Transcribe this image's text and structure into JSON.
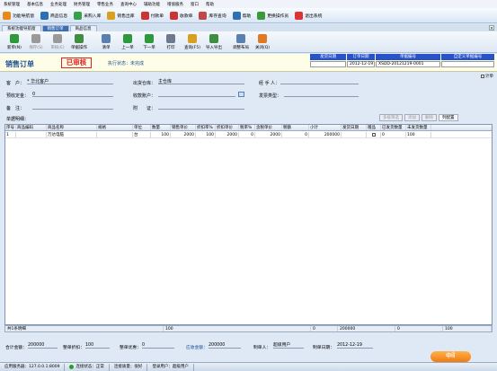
{
  "menu": [
    "系统管理",
    "基本信息",
    "业务处理",
    "财务管理",
    "零售业务",
    "查询中心",
    "辅助功能",
    "增值服务",
    "窗口",
    "帮助"
  ],
  "toolbar": [
    {
      "label": "功能导航窗",
      "icon": "navigation-icon",
      "color": "#e88a1a"
    },
    {
      "label": "商品信息",
      "icon": "product-info-icon",
      "color": "#2f6fb4"
    },
    {
      "label": "采购入库",
      "icon": "purchase-icon",
      "color": "#39a04a"
    },
    {
      "label": "销售出库",
      "icon": "sales-out-icon",
      "color": "#d9a020"
    },
    {
      "label": "付款单",
      "icon": "payment-icon",
      "color": "#c33"
    },
    {
      "label": "收款单",
      "icon": "receipt-icon",
      "color": "#c33"
    },
    {
      "label": "库存查询",
      "icon": "stock-query-icon",
      "color": "#c04848"
    },
    {
      "label": "帮助",
      "icon": "help-icon",
      "color": "#2f6fb4"
    },
    {
      "label": "更换操作员",
      "icon": "switch-user-icon",
      "color": "#3a9a3a"
    },
    {
      "label": "退出系统",
      "icon": "exit-icon",
      "color": "#d33"
    }
  ],
  "tabs": [
    "系统功能导航窗",
    "销售订单",
    "商品信息"
  ],
  "doc_toolbar": [
    {
      "label": "新单(N)",
      "icon": "new-doc-icon",
      "color": "#2c9a3a",
      "disabled": false
    },
    {
      "label": "保存(S)",
      "icon": "save-icon",
      "color": "#9a9a9a",
      "disabled": true
    },
    {
      "label": "审核(E)",
      "icon": "audit-icon",
      "color": "#9a9a9a",
      "disabled": true
    },
    {
      "label": "单据操作",
      "icon": "doc-ops-icon",
      "color": "#3f8d3f",
      "disabled": false
    },
    {
      "label": "清单",
      "icon": "list-icon",
      "color": "#5a7fb0",
      "disabled": false
    },
    {
      "label": "上一单",
      "icon": "prev-doc-icon",
      "color": "#2c9a3a",
      "disabled": false
    },
    {
      "label": "下一单",
      "icon": "next-doc-icon",
      "color": "#2c9a3a",
      "disabled": false
    },
    {
      "label": "打印",
      "icon": "print-icon",
      "color": "#6b7a8f",
      "disabled": false
    },
    {
      "label": "查询(F5)",
      "icon": "query-icon",
      "color": "#d9a020",
      "disabled": false
    },
    {
      "label": "导入导出",
      "icon": "import-export-icon",
      "color": "#3f8d3f",
      "disabled": false
    },
    {
      "label": "调整布局",
      "icon": "layout-icon",
      "color": "#5a7fb0",
      "disabled": false
    },
    {
      "label": "关闭(Q)",
      "icon": "close-doc-icon",
      "color": "#e07a20",
      "disabled": false
    }
  ],
  "header": {
    "title": "销售订单",
    "audit_stamp": "已审核",
    "exec_state": "执行状态：未完成",
    "grid_headers": [
      "发货日期",
      "订单日期",
      "单据编号",
      "自定义单据编号"
    ],
    "ship_date": "",
    "order_date": "2012-12-19",
    "doc_no": "XSDD-20121219-0001",
    "custom_no": ""
  },
  "option_checkbox": "计单",
  "form": {
    "customer_label": "客　户：",
    "customer_value": "* 华北客户",
    "warehouse_label": "出货仓库：",
    "warehouse_value": "主仓库",
    "handler_label": "经 手 人：",
    "handler_value": "",
    "deposit_label": "预收定金：",
    "deposit_value": "0",
    "account_label": "收款账户：",
    "account_value": "",
    "invoice_label": "发票类型：",
    "invoice_value": "",
    "remark_label": "备　注：",
    "remark_value": "",
    "attach_label": "附　　证：",
    "attach_value": "",
    "doc_detail_label": "单据明细："
  },
  "grid_buttons": [
    "多级筛选",
    "添加",
    "删除",
    "列配置"
  ],
  "grid": {
    "columns": [
      "序号",
      "商品编码",
      "商品名称",
      "规格",
      "单位",
      "数量",
      "销售单价",
      "折扣率%",
      "折扣单价",
      "税率%",
      "含税单价",
      "税额",
      "小计",
      "发货日期",
      "赠品",
      "已发货数量",
      "未发货数量"
    ],
    "rows": [
      [
        "1",
        "",
        "万达电脑",
        "",
        "台",
        "100",
        "2000",
        "100",
        "2000",
        "0",
        "2000",
        "0",
        "200000",
        "",
        "",
        "0",
        "100"
      ]
    ],
    "summary": {
      "row_count": "共1条明细",
      "qty": "100",
      "tax": "0",
      "subtotal": "200000",
      "shipped": "0",
      "unshipped": "100"
    }
  },
  "footer": {
    "total_amount_label": "合计金额：",
    "total_amount": "200000",
    "whole_discount_label": "整单折扣：",
    "whole_discount": "100",
    "whole_reduction_label": "整单优惠：",
    "whole_reduction": "0",
    "payable_label": "应收金额：",
    "payable": "200000",
    "maker_label": "制单人：",
    "maker": "超级用户",
    "make_date_label": "制单日期：",
    "make_date": "2012-12-19"
  },
  "mascot_text": "中ꀌ",
  "statusbar": {
    "server": "应用服务器：127.0.0.1:8009",
    "connection": "连接状态：正常",
    "connection_quality": "连接质量：很好",
    "login_user": "登录用户：超级用户"
  }
}
